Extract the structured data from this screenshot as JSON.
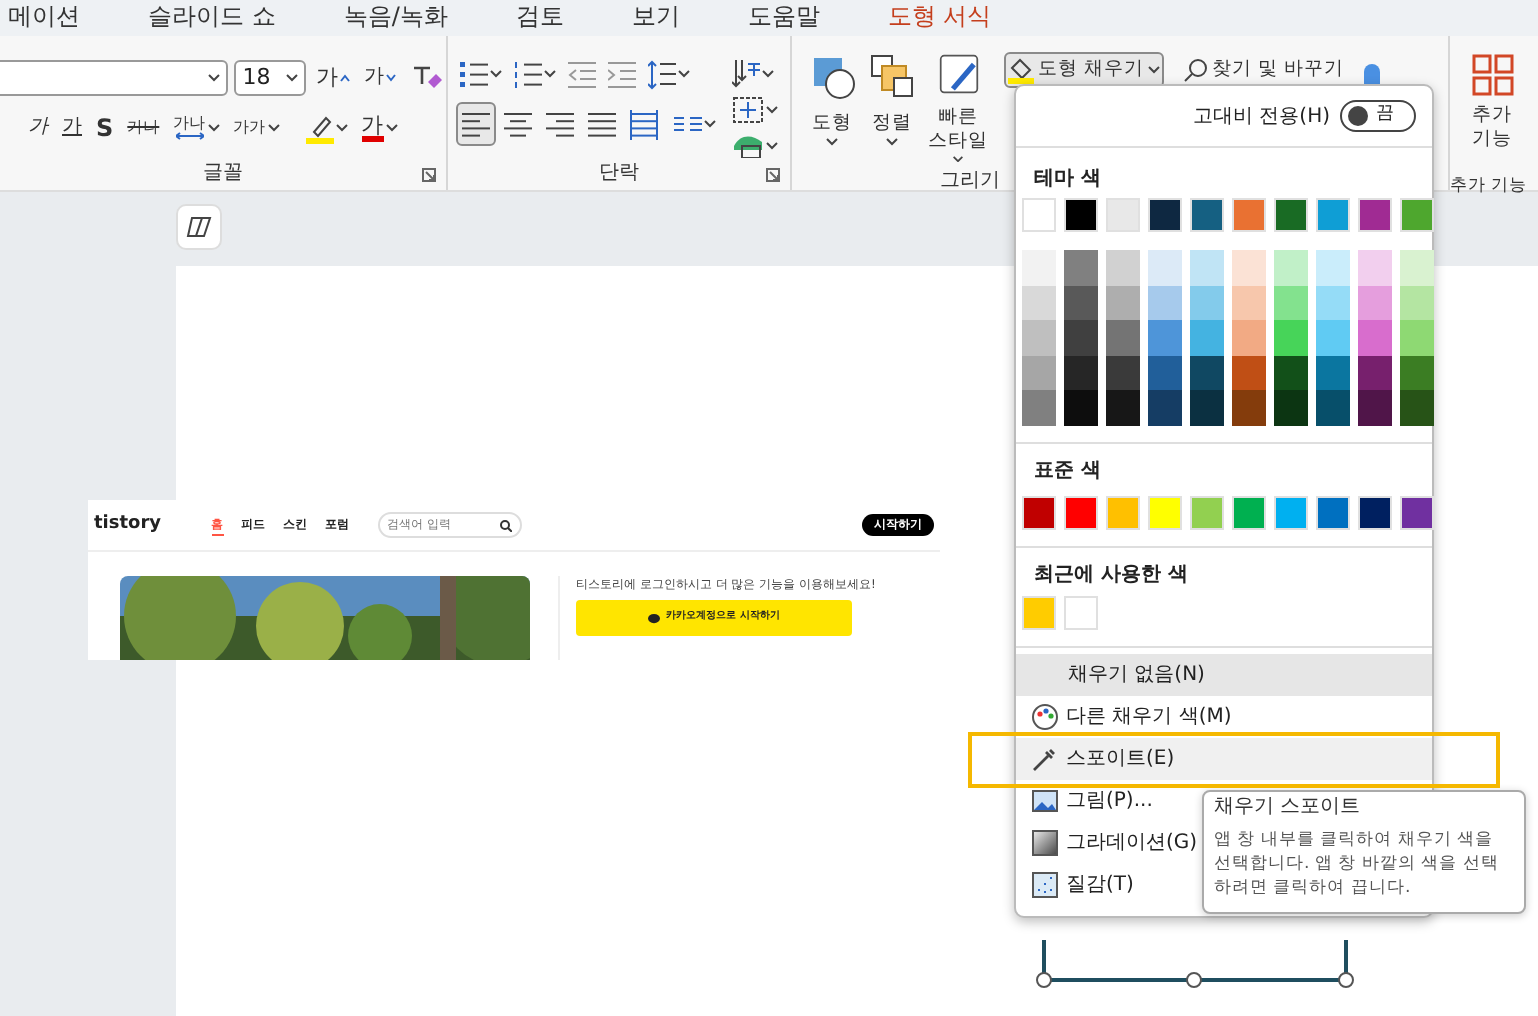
{
  "menu_tabs": [
    {
      "label": "메이션",
      "kind": "normal"
    },
    {
      "label": "슬라이드 쇼",
      "kind": "normal"
    },
    {
      "label": "녹음/녹화",
      "kind": "normal"
    },
    {
      "label": "검토",
      "kind": "normal"
    },
    {
      "label": "보기",
      "kind": "normal"
    },
    {
      "label": "도움말",
      "kind": "normal"
    },
    {
      "label": "도형 서식",
      "kind": "contextual"
    }
  ],
  "font": {
    "label": "글꼴",
    "size": "18",
    "grow": "가",
    "shrink": "가",
    "format_buttons": [
      {
        "label": "가",
        "kind": "italic"
      },
      {
        "label": "가",
        "kind": "underline"
      },
      {
        "label": "S",
        "kind": "shadow"
      },
      {
        "label": "가나",
        "kind": "strike"
      },
      {
        "label": "가나",
        "kind": "spacing"
      },
      {
        "label": "가가",
        "kind": "case"
      }
    ],
    "font_color": "가"
  },
  "paragraph": {
    "label": "단락",
    "alignments": [
      {
        "kind": "left",
        "selected": true
      },
      {
        "kind": "center",
        "selected": false
      },
      {
        "kind": "right",
        "selected": false
      },
      {
        "kind": "justify",
        "selected": false
      },
      {
        "kind": "distributed",
        "selected": false
      }
    ]
  },
  "drawing": {
    "label": "그리기",
    "buttons": [
      {
        "kind": "shapes",
        "label": "도형"
      },
      {
        "kind": "arrange",
        "label": "정렬"
      },
      {
        "kind": "quick_styles",
        "label": "빠른 스타일"
      }
    ],
    "fill_button": {
      "label": "도형 채우기",
      "pressed": true
    },
    "find_button": "찾기 및 바꾸기"
  },
  "addins": {
    "button": "추가 기능",
    "group_label": "추가 기능"
  },
  "fill_menu": {
    "high_contrast": {
      "label": "고대비 전용(H)",
      "on": false,
      "state_text": "끔"
    },
    "theme_label": "테마 색",
    "theme_colors": [
      {
        "color": "#ffffff",
        "shades": [
          {
            "color": "#f2f2f2"
          },
          {
            "color": "#d9d9d9"
          },
          {
            "color": "#bfbfbf"
          },
          {
            "color": "#a6a6a6"
          },
          {
            "color": "#808080"
          }
        ]
      },
      {
        "color": "#000000",
        "shades": [
          {
            "color": "#808080"
          },
          {
            "color": "#595959"
          },
          {
            "color": "#404040"
          },
          {
            "color": "#262626"
          },
          {
            "color": "#0d0d0d"
          }
        ]
      },
      {
        "color": "#e8e8e8",
        "shades": [
          {
            "color": "#d1d1d1"
          },
          {
            "color": "#aeaeae"
          },
          {
            "color": "#747474"
          },
          {
            "color": "#3a3a3a"
          },
          {
            "color": "#171717"
          }
        ]
      },
      {
        "color": "#0e2841",
        "shades": [
          {
            "color": "#dceaf7"
          },
          {
            "color": "#a6caec"
          },
          {
            "color": "#4e95d9"
          },
          {
            "color": "#215f9a"
          },
          {
            "color": "#153d64"
          }
        ]
      },
      {
        "color": "#156082",
        "shades": [
          {
            "color": "#c0e4f5"
          },
          {
            "color": "#83cbeb"
          },
          {
            "color": "#44b3e1"
          },
          {
            "color": "#104862"
          },
          {
            "color": "#0b3041"
          }
        ]
      },
      {
        "color": "#e97132",
        "shades": [
          {
            "color": "#fbe2d5"
          },
          {
            "color": "#f7c7ac"
          },
          {
            "color": "#f2aa84"
          },
          {
            "color": "#c04f15"
          },
          {
            "color": "#843c0c"
          }
        ]
      },
      {
        "color": "#196b24",
        "shades": [
          {
            "color": "#c1f0c8"
          },
          {
            "color": "#83e28e"
          },
          {
            "color": "#47d459"
          },
          {
            "color": "#125019"
          },
          {
            "color": "#0c3512"
          }
        ]
      },
      {
        "color": "#0f9ed5",
        "shades": [
          {
            "color": "#caedfb"
          },
          {
            "color": "#95dcf7"
          },
          {
            "color": "#60cbf3"
          },
          {
            "color": "#0b76a0"
          },
          {
            "color": "#074f6a"
          }
        ]
      },
      {
        "color": "#a02b93",
        "shades": [
          {
            "color": "#f2cfee"
          },
          {
            "color": "#e59edd"
          },
          {
            "color": "#d86dcd"
          },
          {
            "color": "#77206d"
          },
          {
            "color": "#501549"
          }
        ]
      },
      {
        "color": "#4ea72e",
        "shades": [
          {
            "color": "#d9f2d0"
          },
          {
            "color": "#b4e5a2"
          },
          {
            "color": "#8ed973"
          },
          {
            "color": "#3b7d23"
          },
          {
            "color": "#275317"
          }
        ]
      }
    ],
    "standard_label": "표준 색",
    "standard_colors": [
      {
        "color": "#c00000"
      },
      {
        "color": "#ff0000"
      },
      {
        "color": "#ffc000"
      },
      {
        "color": "#ffff00"
      },
      {
        "color": "#92d050"
      },
      {
        "color": "#00b050"
      },
      {
        "color": "#00b0f0"
      },
      {
        "color": "#0070c0"
      },
      {
        "color": "#002060"
      },
      {
        "color": "#7030a0"
      }
    ],
    "recent_label": "최근에 사용한 색",
    "recent_colors": [
      {
        "color": "#ffcc00"
      },
      {
        "color": "#ffffff"
      }
    ],
    "items": [
      {
        "label": "채우기 없음(N)",
        "kind": "no_fill",
        "selected": true,
        "hovered": false
      },
      {
        "label": "다른 채우기 색(M)",
        "kind": "more_colors",
        "selected": false,
        "hovered": false
      },
      {
        "label": "스포이트(E)",
        "kind": "eyedropper",
        "selected": false,
        "hovered": true
      },
      {
        "label": "그림(P)...",
        "kind": "picture",
        "selected": false,
        "hovered": false
      },
      {
        "label": "그라데이션(G)",
        "kind": "gradient",
        "selected": false,
        "hovered": false
      },
      {
        "label": "질감(T)",
        "kind": "texture",
        "selected": false,
        "hovered": false
      }
    ]
  },
  "tooltip": {
    "title": "채우기 스포이트",
    "text": "앱 창 내부를 클릭하여 채우기 색을 선택합니다. 앱 창 바깥의 색을 선택하려면 클릭하여 끕니다."
  },
  "slide_image": {
    "logo": "tistory",
    "nav": [
      {
        "label": "홈",
        "selected": true
      },
      {
        "label": "피드",
        "selected": false
      },
      {
        "label": "스킨",
        "selected": false
      },
      {
        "label": "포럼",
        "selected": false
      }
    ],
    "search_placeholder": "검색어 입력",
    "start_button": "시작하기",
    "login_text": "티스토리에 로그인하시고 더 많은 기능을 이용해보세요!",
    "kakao_button": "카카오계정으로 시작하기"
  }
}
